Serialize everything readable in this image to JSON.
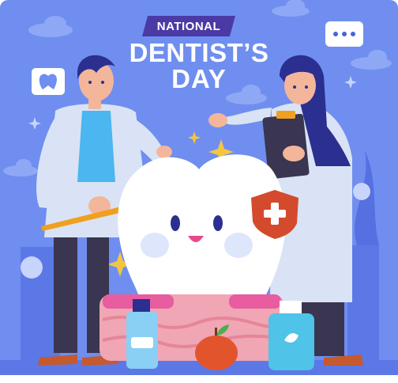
{
  "banner": {
    "label": "NATIONAL"
  },
  "title": {
    "line1": "DENTIST’S",
    "line2": "DAY"
  },
  "colors": {
    "background": "#6f8ef0",
    "panel_bottom": "#5b78e6",
    "banner": "#4b3aa6",
    "tooth": "#ffffff",
    "coat": "#d9e3f5",
    "hair": "#2b2f8f",
    "shirt": "#4bb6f0",
    "badge": "#d44a2c"
  },
  "icons": [
    "chat-bubble-icon",
    "tooth-icon",
    "plus-badge-icon",
    "cloud-icon",
    "sparkle-icon",
    "toothbrush-icon",
    "clipboard-icon",
    "mouthwash-icon",
    "apple-icon"
  ]
}
